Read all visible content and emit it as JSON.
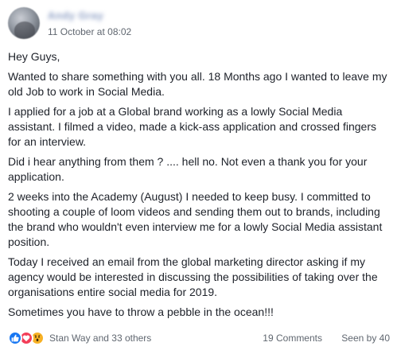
{
  "post": {
    "author_name": "Andy Gray",
    "timestamp": "11 October at 08:02",
    "paragraphs": [
      "Hey Guys,",
      "Wanted to share something with you all. 18 Months ago I wanted to leave my old Job to work in Social Media.",
      "I applied for a job at a Global brand working as a lowly Social Media assistant. I filmed a video, made a kick-ass application and crossed fingers for an interview.",
      "Did i hear anything from them ? .... hell no. Not even a thank you for your application.",
      "2 weeks into the Academy (August) I needed to keep busy. I committed to shooting a couple of loom videos and sending them out to brands, including the brand who wouldn't even interview me for a lowly Social Media assistant position.",
      "Today I received an email from the global marketing director asking if my agency would be interested in discussing the possibilities of taking over the organisations entire social media for 2019.",
      "Sometimes you have to throw a pebble in the ocean!!!"
    ]
  },
  "footer": {
    "reaction_icons": [
      "like-icon",
      "love-icon",
      "wow-icon"
    ],
    "reaction_names": "Stan Way and 33 others",
    "comments": "19 Comments",
    "seen": "Seen by 40"
  },
  "colors": {
    "like": "#1877f2",
    "love": "#f33e58",
    "wow": "#f7b125",
    "text": "#1d2129",
    "meta": "#606770"
  }
}
